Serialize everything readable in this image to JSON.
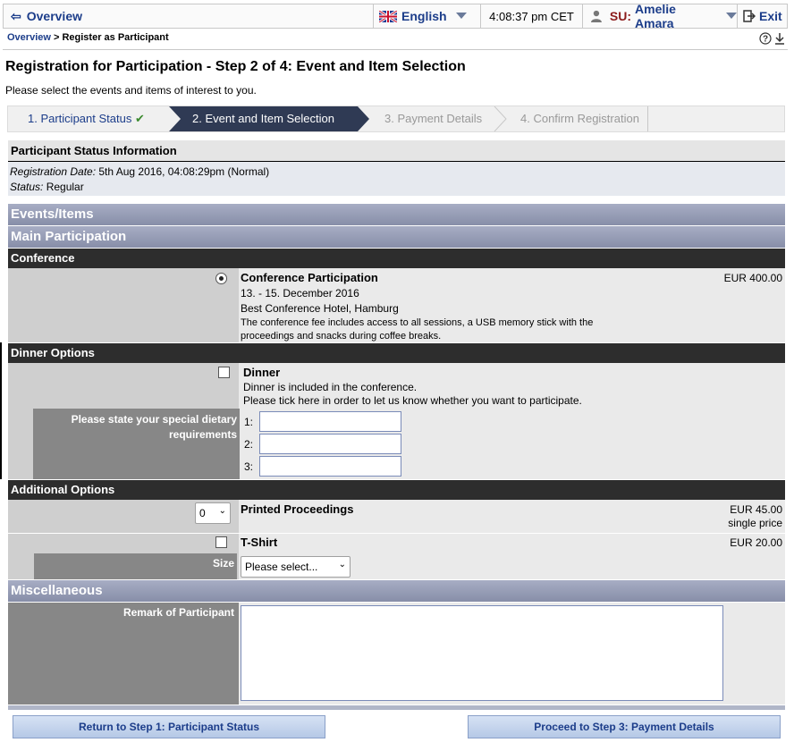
{
  "topbar": {
    "overview": "Overview",
    "language": "English",
    "time": "4:08:37 pm CET",
    "user_prefix": "SU:",
    "user_name": "Amelie Amara",
    "exit": "Exit"
  },
  "breadcrumb": {
    "link": "Overview",
    "separator": " > ",
    "current": "Register as Participant"
  },
  "page": {
    "title": "Registration for Participation - Step 2 of 4: Event and Item Selection",
    "intro": "Please select the events and items of interest to you."
  },
  "steps": [
    {
      "label": "1. Participant Status",
      "check": "✔"
    },
    {
      "label": "2. Event and Item Selection"
    },
    {
      "label": "3. Payment Details"
    },
    {
      "label": "4. Confirm Registration"
    }
  ],
  "participant_status": {
    "heading": "Participant Status Information",
    "reg_label": "Registration Date:",
    "reg_value": " 5th Aug 2016, 04:08:29pm (Normal)",
    "status_label": "Status:",
    "status_value": " Regular"
  },
  "sections": {
    "events_items": "Events/Items",
    "main_participation": "Main Participation",
    "conference": "Conference",
    "dinner_options": "Dinner Options",
    "additional_options": "Additional Options",
    "miscellaneous": "Miscellaneous"
  },
  "conference": {
    "title": "Conference Participation",
    "dates": "13. - 15. December 2016",
    "venue": "Best Conference Hotel, Hamburg",
    "desc1": "The conference fee includes access to all sessions, a USB memory stick with the",
    "desc2": "proceedings and snacks during coffee breaks.",
    "price": "EUR 400.00"
  },
  "dinner": {
    "title": "Dinner",
    "line1": "Dinner is included in the conference.",
    "line2": "Please tick here in order to let us know whether you want to participate.",
    "diet_label": "Please state your special dietary requirements",
    "fields": [
      "1:",
      "2:",
      "3:"
    ]
  },
  "proceedings": {
    "qty": "0",
    "title": "Printed Proceedings",
    "price": "EUR 45.00",
    "price_note": "single price"
  },
  "tshirt": {
    "title": "T-Shirt",
    "price": "EUR 20.00",
    "size_label": "Size",
    "size_value": "Please select..."
  },
  "misc": {
    "remark_label": "Remark of Participant"
  },
  "buttons": {
    "back": "Return to Step 1: Participant Status",
    "next": "Proceed to Step 3: Payment Details"
  },
  "colors": {
    "link": "#1c3d8a",
    "user": "#8b1a1a",
    "step_active": "#2f3a54"
  }
}
